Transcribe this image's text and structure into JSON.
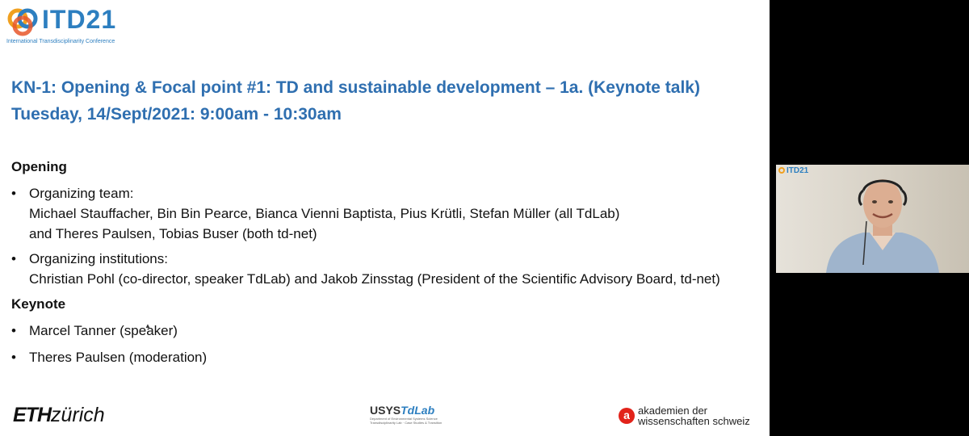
{
  "logo": {
    "brand": "ITD21",
    "subtitle": "International Transdisciplinarity Conference"
  },
  "title": "KN-1: Opening & Focal point #1: TD and sustainable development – 1a. (Keynote talk)",
  "date": "Tuesday, 14/Sept/2021: 9:00am - 10:30am",
  "opening": {
    "heading": "Opening",
    "items": [
      {
        "label": "Organizing team:",
        "lines": [
          "Michael Stauffacher, Bin Bin Pearce, Bianca Vienni Baptista, Pius Krütli, Stefan Müller (all TdLab)",
          "and Theres Paulsen, Tobias Buser (both td-net)"
        ]
      },
      {
        "label": "Organizing institutions:",
        "lines": [
          "Christian Pohl (co-director, speaker TdLab) and Jakob Zinsstag (President of the Scientific Advisory Board, td-net)"
        ]
      }
    ]
  },
  "keynote": {
    "heading": "Keynote",
    "items": [
      "Marcel Tanner (speaker)",
      "Theres Paulsen (moderation)"
    ]
  },
  "footer": {
    "eth_bold": "ETH",
    "eth_rest": "zürich",
    "usys_main": "USYS",
    "usys_accent": "TdLab",
    "usys_sub1": "Department of Environmental Systems Science",
    "usys_sub2": "Transdisciplinarity Lab · Case Studies & Transition",
    "akademien_line1": "akademien der",
    "akademien_line2": "wissenschaften schweiz"
  },
  "video": {
    "logo": "ITD21"
  },
  "colors": {
    "accent": "#2f6fb0",
    "akademien": "#e2231a"
  }
}
